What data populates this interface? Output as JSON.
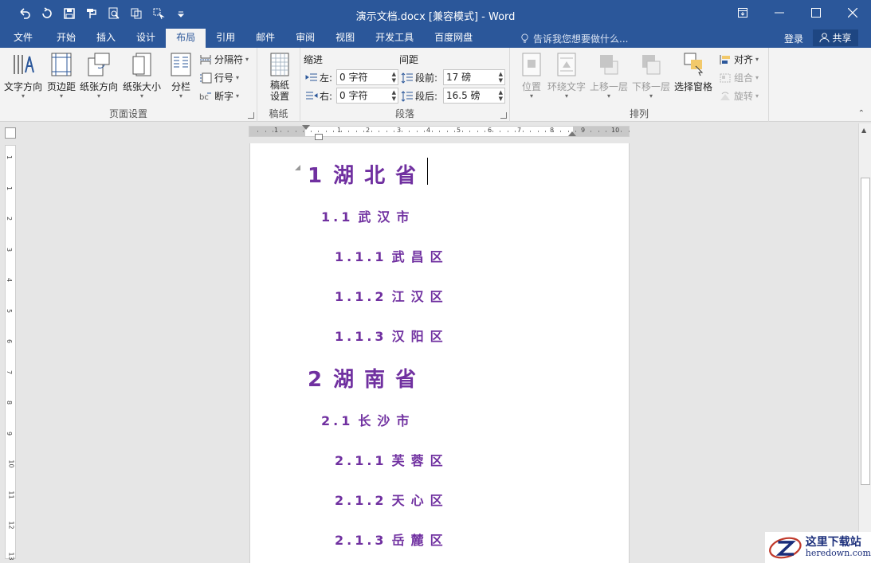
{
  "window": {
    "title": "演示文档.docx [兼容模式] - Word"
  },
  "qat": {
    "icons": [
      "undo-icon",
      "redo-icon",
      "save-icon",
      "format-painter-icon",
      "print-preview-icon",
      "copy-format-icon",
      "select-icon",
      "customize-icon"
    ]
  },
  "tabs": [
    {
      "label": "文件"
    },
    {
      "label": "开始"
    },
    {
      "label": "插入"
    },
    {
      "label": "设计"
    },
    {
      "label": "布局",
      "active": true
    },
    {
      "label": "引用"
    },
    {
      "label": "邮件"
    },
    {
      "label": "审阅"
    },
    {
      "label": "视图"
    },
    {
      "label": "开发工具"
    },
    {
      "label": "百度网盘"
    }
  ],
  "tellme": {
    "placeholder": "告诉我您想要做什么..."
  },
  "account": {
    "login": "登录",
    "share": "共享"
  },
  "ribbon": {
    "page_setup": {
      "label": "页面设置",
      "text_direction": "文字方向",
      "margins": "页边距",
      "orientation": "纸张方向",
      "size": "纸张大小",
      "columns": "分栏",
      "breaks": "分隔符",
      "line_numbers": "行号",
      "hyphenation": "断字"
    },
    "manuscript": {
      "label": "稿纸",
      "setup": "稿纸\n设置",
      "setup_line1": "稿纸",
      "setup_line2": "设置"
    },
    "paragraph": {
      "label": "段落",
      "indent_title": "缩进",
      "spacing_title": "间距",
      "left_label": "左:",
      "left_value": "0 字符",
      "right_label": "右:",
      "right_value": "0 字符",
      "before_label": "段前:",
      "before_value": "17 磅",
      "after_label": "段后:",
      "after_value": "16.5 磅"
    },
    "arrange": {
      "label": "排列",
      "position": "位置",
      "wrap_text": "环绕文字",
      "bring_forward": "上移一层",
      "send_backward": "下移一层",
      "selection_pane": "选择窗格",
      "align": "对齐",
      "group": "组合",
      "rotate": "旋转"
    }
  },
  "ruler": {
    "h_ticks": [
      "1",
      "1",
      "2",
      "1",
      "2",
      "3",
      "4",
      "5",
      "6",
      "7",
      "8",
      "9",
      "10"
    ],
    "v_ticks": [
      "1",
      "1",
      "2",
      "3",
      "4",
      "5",
      "6",
      "7",
      "8",
      "9",
      "10",
      "11",
      "12",
      "13"
    ]
  },
  "document": {
    "headings": [
      {
        "level": 1,
        "num": "1",
        "text": "湖北省"
      },
      {
        "level": 2,
        "num": "1.1",
        "text": "武汉市"
      },
      {
        "level": 3,
        "num": "1.1.1",
        "text": "武昌区"
      },
      {
        "level": 3,
        "num": "1.1.2",
        "text": "江汉区"
      },
      {
        "level": 3,
        "num": "1.1.3",
        "text": "汉阳区"
      },
      {
        "level": 1,
        "num": "2",
        "text": "湖南省"
      },
      {
        "level": 2,
        "num": "2.1",
        "text": "长沙市"
      },
      {
        "level": 3,
        "num": "2.1.1",
        "text": "芙蓉区"
      },
      {
        "level": 3,
        "num": "2.1.2",
        "text": "天心区"
      },
      {
        "level": 3,
        "num": "2.1.3",
        "text": "岳麓区"
      }
    ]
  },
  "watermark": {
    "cn": "这里下载站",
    "en": "heredown.com"
  },
  "colors": {
    "accent": "#2b579a",
    "heading": "#7030a0"
  }
}
